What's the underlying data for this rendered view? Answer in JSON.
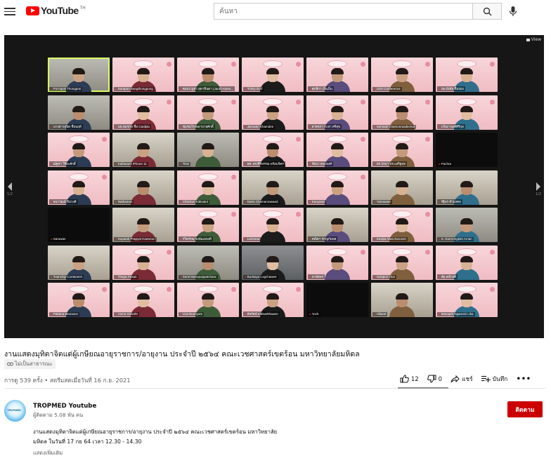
{
  "header": {
    "logo_text": "YouTube",
    "logo_superscript": "TH",
    "search_placeholder": "ค้นหา",
    "icons": [
      "menu-icon",
      "search-icon",
      "mic-icon"
    ]
  },
  "player": {
    "view_label": "View",
    "page_left": "1/2",
    "page_right": "1/2",
    "participants": [
      {
        "name": "Porrapak Thongprai",
        "bg": "office",
        "active": true
      },
      {
        "name": "Surapon Sangthongpong",
        "bg": "pink"
      },
      {
        "name": "คุณนาฏยา สุดาชินดา (Jardit Amen...",
        "bg": "pink"
      },
      {
        "name": "Trinity Dorf",
        "bg": "pink"
      },
      {
        "name": "ศุภสิกา เงินเย็น",
        "bg": "pink"
      },
      {
        "name": "LDO Conference",
        "bg": "pink"
      },
      {
        "name": "นพ.มีเดีย ชื่อปอง",
        "bg": "pink"
      },
      {
        "name": "นางสาวสุนิด ชื่อนฤดี",
        "bg": "office"
      },
      {
        "name": "นพ.สมชาย ชื่อ Cardplu",
        "bg": "pink"
      },
      {
        "name": "ชุมชนโรงพยาบาลศักดิ์",
        "bg": "pink"
      },
      {
        "name": "Jaruwan Khamdee",
        "bg": "pink"
      },
      {
        "name": "สาครภา ระฟา ศรีสุข",
        "bg": "pink"
      },
      {
        "name": "Somsak Chamonrasdechar",
        "bg": "pink"
      },
      {
        "name": "ปวีณา พงศ์ศิริกุล",
        "bg": "pink"
      },
      {
        "name": "ณัฐชา วิริยะศักดิ์",
        "bg": "pink"
      },
      {
        "name": "Kathana's iPhone 11",
        "bg": "room"
      },
      {
        "name": "Tiew",
        "bg": "office"
      },
      {
        "name": "ผศ. ดร.ศิริพรรณ พร้อมจิตร",
        "bg": "pink"
      },
      {
        "name": "รัตนา ธนะพงศ์",
        "bg": "pink"
      },
      {
        "name": "ดร.ปรมา ประเสริฐสุข",
        "bg": "pink"
      },
      {
        "name": "Pachra",
        "bg": "dark"
      },
      {
        "name": "ธนาวัฒน์ ทิมวงศ์",
        "bg": "pink"
      },
      {
        "name": "Nathamon",
        "bg": "room"
      },
      {
        "name": "Chitchon Kittivatul",
        "bg": "pink"
      },
      {
        "name": "Darin Chamanrawaed",
        "bg": "room"
      },
      {
        "name": "Kanyarat",
        "bg": "pink"
      },
      {
        "name": "Yanrawee",
        "bg": "room"
      },
      {
        "name": "รัฐิพร คำมงคล",
        "bg": "room"
      },
      {
        "name": "Sarawan",
        "bg": "dark"
      },
      {
        "name": "Supatuk Prapyat Kaewsun",
        "bg": "room"
      },
      {
        "name": "รวิพรรณ จงพัฒนพงศ์",
        "bg": "pink"
      },
      {
        "name": "Lamrana",
        "bg": "pink"
      },
      {
        "name": "คณิตา ชาญกัมพล",
        "bg": "room"
      },
      {
        "name": "Suvipa Vanicharunsri",
        "bg": "pink"
      },
      {
        "name": "S. Dumrongkiet Arnan",
        "bg": "office"
      },
      {
        "name": "Tuanchip Coetaneen",
        "bg": "room"
      },
      {
        "name": "Thepa Pusan",
        "bg": "pink"
      },
      {
        "name": "Santi Manopoppatchara",
        "bg": "office"
      },
      {
        "name": "Budsaya Logchawee",
        "bg": "gray"
      },
      {
        "name": "มาลัยพร",
        "bg": "pink"
      },
      {
        "name": "narapon chai",
        "bg": "pink"
      },
      {
        "name": "ลัฐ มณีวงศ์",
        "bg": "pink"
      },
      {
        "name": "Pattana Manasun",
        "bg": "pink"
      },
      {
        "name": "Anirut Siviraht",
        "bg": "pink"
      },
      {
        "name": "Lisa Boonyam",
        "bg": "pink"
      },
      {
        "name": "ลีลรัตน์ Kittiwetthawen",
        "bg": "pink"
      },
      {
        "name": "Yoch",
        "bg": "dark"
      },
      {
        "name": "Vilavat",
        "bg": "room"
      },
      {
        "name": "Manaphi Ngamsiri Lika",
        "bg": "pink"
      }
    ]
  },
  "video": {
    "title": "งานแสดงมุทิตาจิตแด่ผู้เกษียณอายุราชการ/อายุงาน ประจำปี ๒๕๖๔ คณะเวชศาสตร์เขตร้อน มหาวิทยาลัยมหิดล",
    "privacy": "ไม่เป็นสาธารณะ",
    "stats": "การดู 539 ครั้ง • สตรีมสดเมื่อวันที่ 16 ก.ย. 2021",
    "likes": "12",
    "dislikes": "0",
    "share_label": "แชร์",
    "save_label": "บันทึก",
    "more_label": "•••"
  },
  "channel": {
    "name": "TROPMED Youtube",
    "subscribers": "ผู้ติดตาม 5.08 พัน คน",
    "avatar_label": "TROPMED",
    "subscribe_label": "ติดตาม",
    "subscribe_color": "#cc0000"
  },
  "description": {
    "line1": "งานแสดงมุทิตาจิตแด่ผู้เกษียณอายุราชการ/อายุงาน ประจำปี ๒๕๖๔ คณะเวชศาสตร์เขตร้อน มหาวิทยาลัย",
    "line2": "มหิดล ในวันที่ 17 กย 64 เวลา 12.30 - 14.30",
    "show_more": "แสดงเพิ่มเติม"
  }
}
